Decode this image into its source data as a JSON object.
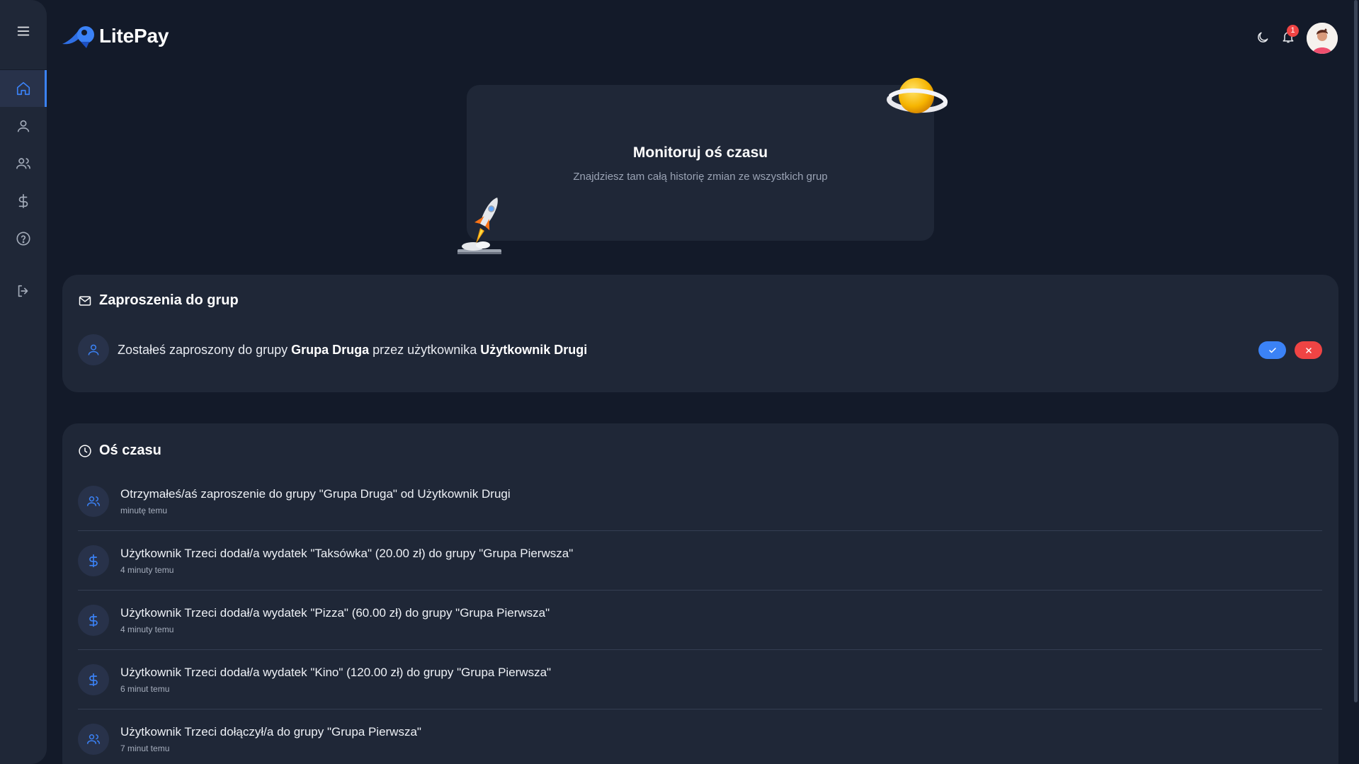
{
  "app": {
    "name": "LitePay"
  },
  "header": {
    "notification_count": "1"
  },
  "hero": {
    "title": "Monitoruj oś czasu",
    "subtitle": "Znajdziesz tam całą historię zmian ze wszystkich grup"
  },
  "invitations": {
    "title": "Zaproszenia do grup",
    "items": [
      {
        "prefix": "Zostałeś zaproszony do grupy ",
        "group": "Grupa Druga",
        "middle": " przez użytkownika ",
        "user": "Użytkownik Drugi"
      }
    ]
  },
  "timeline": {
    "title": "Oś czasu",
    "items": [
      {
        "icon": "users-icon",
        "text": "Otrzymałeś/aś zaproszenie do grupy \"Grupa Druga\" od Użytkownik Drugi",
        "time": "minutę temu"
      },
      {
        "icon": "dollar-icon",
        "text": "Użytkownik Trzeci dodał/a wydatek \"Taksówka\" (20.00 zł) do grupy \"Grupa Pierwsza\"",
        "time": "4 minuty temu"
      },
      {
        "icon": "dollar-icon",
        "text": "Użytkownik Trzeci dodał/a wydatek \"Pizza\" (60.00 zł) do grupy \"Grupa Pierwsza\"",
        "time": "4 minuty temu"
      },
      {
        "icon": "dollar-icon",
        "text": "Użytkownik Trzeci dodał/a wydatek \"Kino\" (120.00 zł) do grupy \"Grupa Pierwsza\"",
        "time": "6 minut temu"
      },
      {
        "icon": "users-icon",
        "text": "Użytkownik Trzeci dołączył/a do grupy \"Grupa Pierwsza\"",
        "time": "7 minut temu"
      }
    ]
  },
  "colors": {
    "accent": "#3b82f6",
    "danger": "#ef4444",
    "card": "#1f2737",
    "background": "#131a29"
  }
}
